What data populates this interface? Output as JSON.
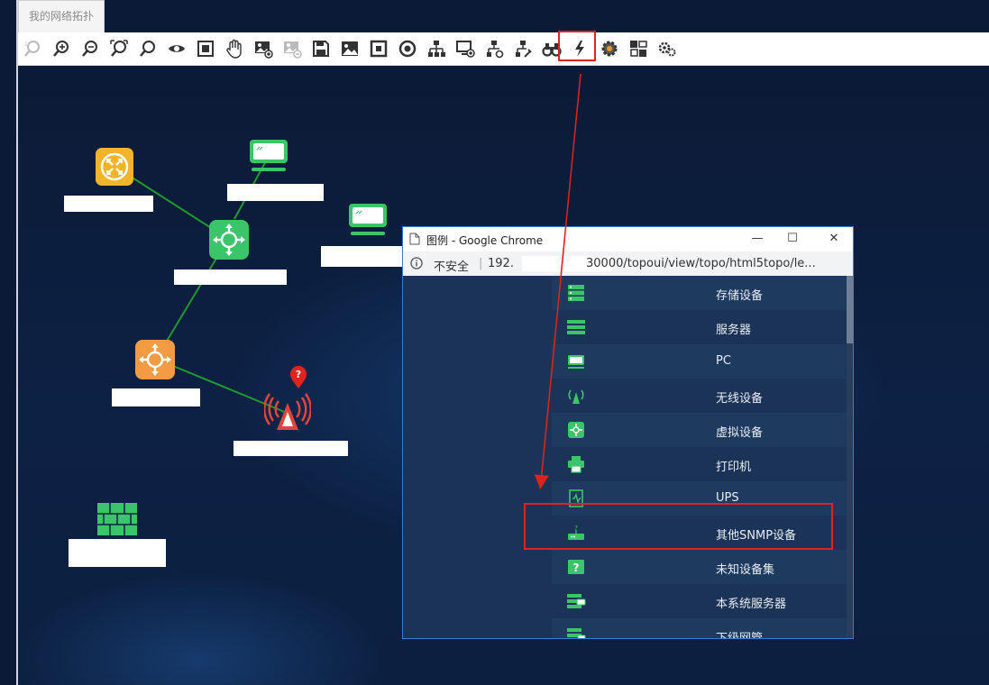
{
  "tab": {
    "label": "我的网络拓扑"
  },
  "toolbar": {
    "icons": [
      "zoom-reset-icon",
      "zoom-in-icon",
      "zoom-out-icon",
      "zoom-fit-icon",
      "search-icon",
      "eye-icon",
      "fullscreen-icon",
      "hand-pan-icon",
      "image-add-icon",
      "image-remove-icon",
      "save-icon",
      "picture-icon",
      "frame-icon",
      "target-icon",
      "hierarchy-icon",
      "monitor-add-icon",
      "network-icon",
      "tools-icon",
      "binoculars-icon",
      "legend-icon",
      "gear-icon",
      "layout-icon",
      "settings-icon"
    ]
  },
  "popup": {
    "title": "图例 - Google Chrome",
    "insecure": "不安全",
    "url_part1": "192.",
    "url_part2": "30000/topoui/view/topo/html5topo/le...",
    "minimize": "—",
    "maximize": "☐",
    "close": "✕"
  },
  "legend": [
    {
      "label": "存储设备",
      "icon": "storage-icon"
    },
    {
      "label": "服务器",
      "icon": "server-icon"
    },
    {
      "label": "PC",
      "icon": "pc-icon"
    },
    {
      "label": "无线设备",
      "icon": "wireless-icon"
    },
    {
      "label": "虚拟设备",
      "icon": "virtual-icon"
    },
    {
      "label": "打印机",
      "icon": "printer-icon"
    },
    {
      "label": "UPS",
      "icon": "ups-icon"
    },
    {
      "label": "其他SNMP设备",
      "icon": "snmp-icon"
    },
    {
      "label": "未知设备集",
      "icon": "unknown-icon"
    },
    {
      "label": "本系统服务器",
      "icon": "local-server-icon"
    },
    {
      "label": "下级网管",
      "icon": "sub-manager-icon"
    }
  ],
  "colors": {
    "accent_red": "#e0241c",
    "green": "#3cc46a",
    "yellow": "#f3b32b",
    "orange": "#f29a44",
    "link": "#1f9a2c"
  }
}
